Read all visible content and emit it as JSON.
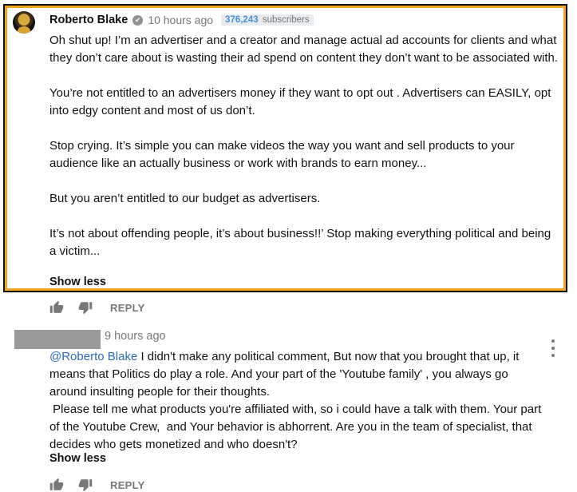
{
  "comment1": {
    "author": "Roberto Blake",
    "verified_icon": "✔",
    "time": "10 hours ago",
    "subscribers_count": "376,243",
    "subscribers_label": "subscribers",
    "paragraphs": [
      "Oh shut up! I’m an advertiser and a creator and manage actual ad accounts for clients and what they don’t care about is wasting their ad spend on content they don’t want to be associated with.",
      "You’re not entitled to an advertisers money if they want to opt out . Advertisers can EASILY, opt into edgy content and most of us don’t.",
      "Stop crying. It’s simple you can make videos the way you want and sell products to your audience like an actually business or work with brands to earn money...",
      "But you aren’t entitled to our budget as advertisers.",
      "It’s not about offending people, it’s about business!!’ Stop making everything political and being a victim..."
    ],
    "show_less": "Show less",
    "reply_label": "REPLY",
    "highlight_color": "#f0a41c"
  },
  "comment2": {
    "time": "9 hours ago",
    "mention": "@Roberto Blake",
    "line1_rest": " I didn't make any political comment, But now that you brought that up, it means that Politics do play a role. And your part of the 'Youtube family' , you always go around insulting people for their thoughts.",
    "line2": " Please tell me what products you're affiliated with, so i could have a talk with them. Your part of the Youtube Crew,  and Your behavior is abhorrent. Are you in the team of specialist, that decides who gets monetized and who doesn't?",
    "show_less": "Show less",
    "reply_label": "REPLY"
  },
  "colors": {
    "link": "#2a6bc2",
    "muted": "#777777"
  }
}
